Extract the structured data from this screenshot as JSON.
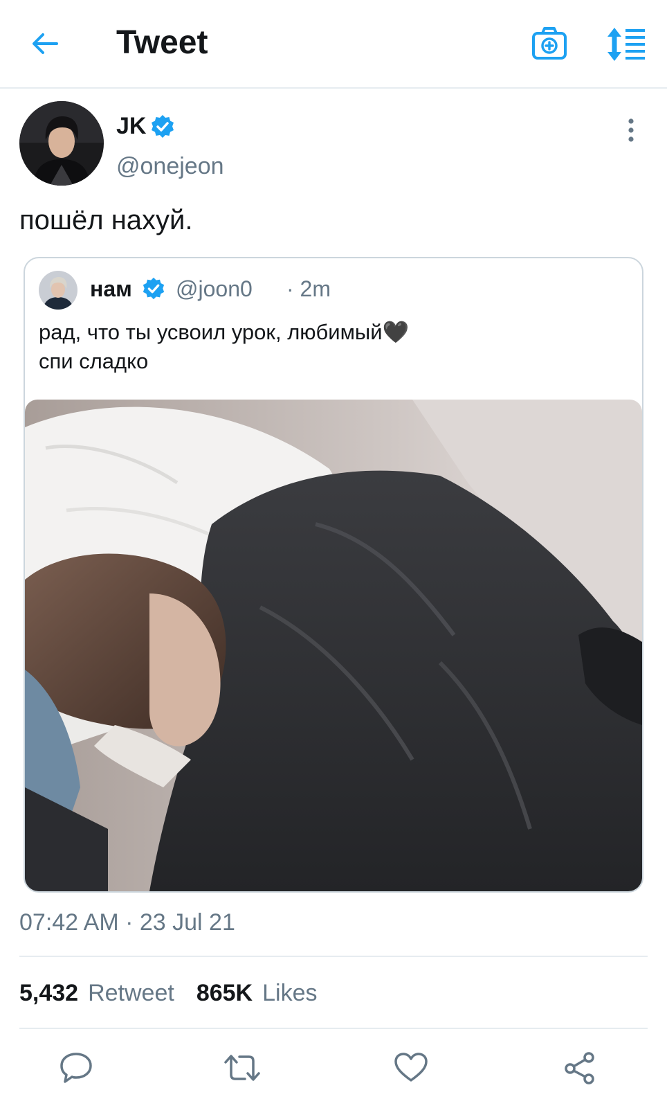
{
  "colors": {
    "accent": "#1da1f2",
    "text": "#14171a",
    "secondary": "#657786",
    "border": "#e6ecf0"
  },
  "header": {
    "title": "Tweet",
    "icons": [
      "back-arrow-icon",
      "camera-plus-icon",
      "sort-icon"
    ]
  },
  "tweet": {
    "author_name": "JK",
    "author_handle": "@onejeon",
    "text": "пошёл нахуй.",
    "timestamp": "07:42 AM · 23 Jul 21"
  },
  "quote": {
    "name": "нам",
    "handle": "@joon0",
    "time": "· 2m",
    "line1": "рад, что ты усвоил урок, любимый",
    "emoji": "🖤",
    "line2": "спи сладко"
  },
  "stats": {
    "retweets_count": "5,432",
    "retweets_label": "Retweet",
    "likes_count": "865K",
    "likes_label": "Likes"
  },
  "actions": [
    "reply-icon",
    "retweet-icon",
    "like-icon",
    "share-icon"
  ]
}
